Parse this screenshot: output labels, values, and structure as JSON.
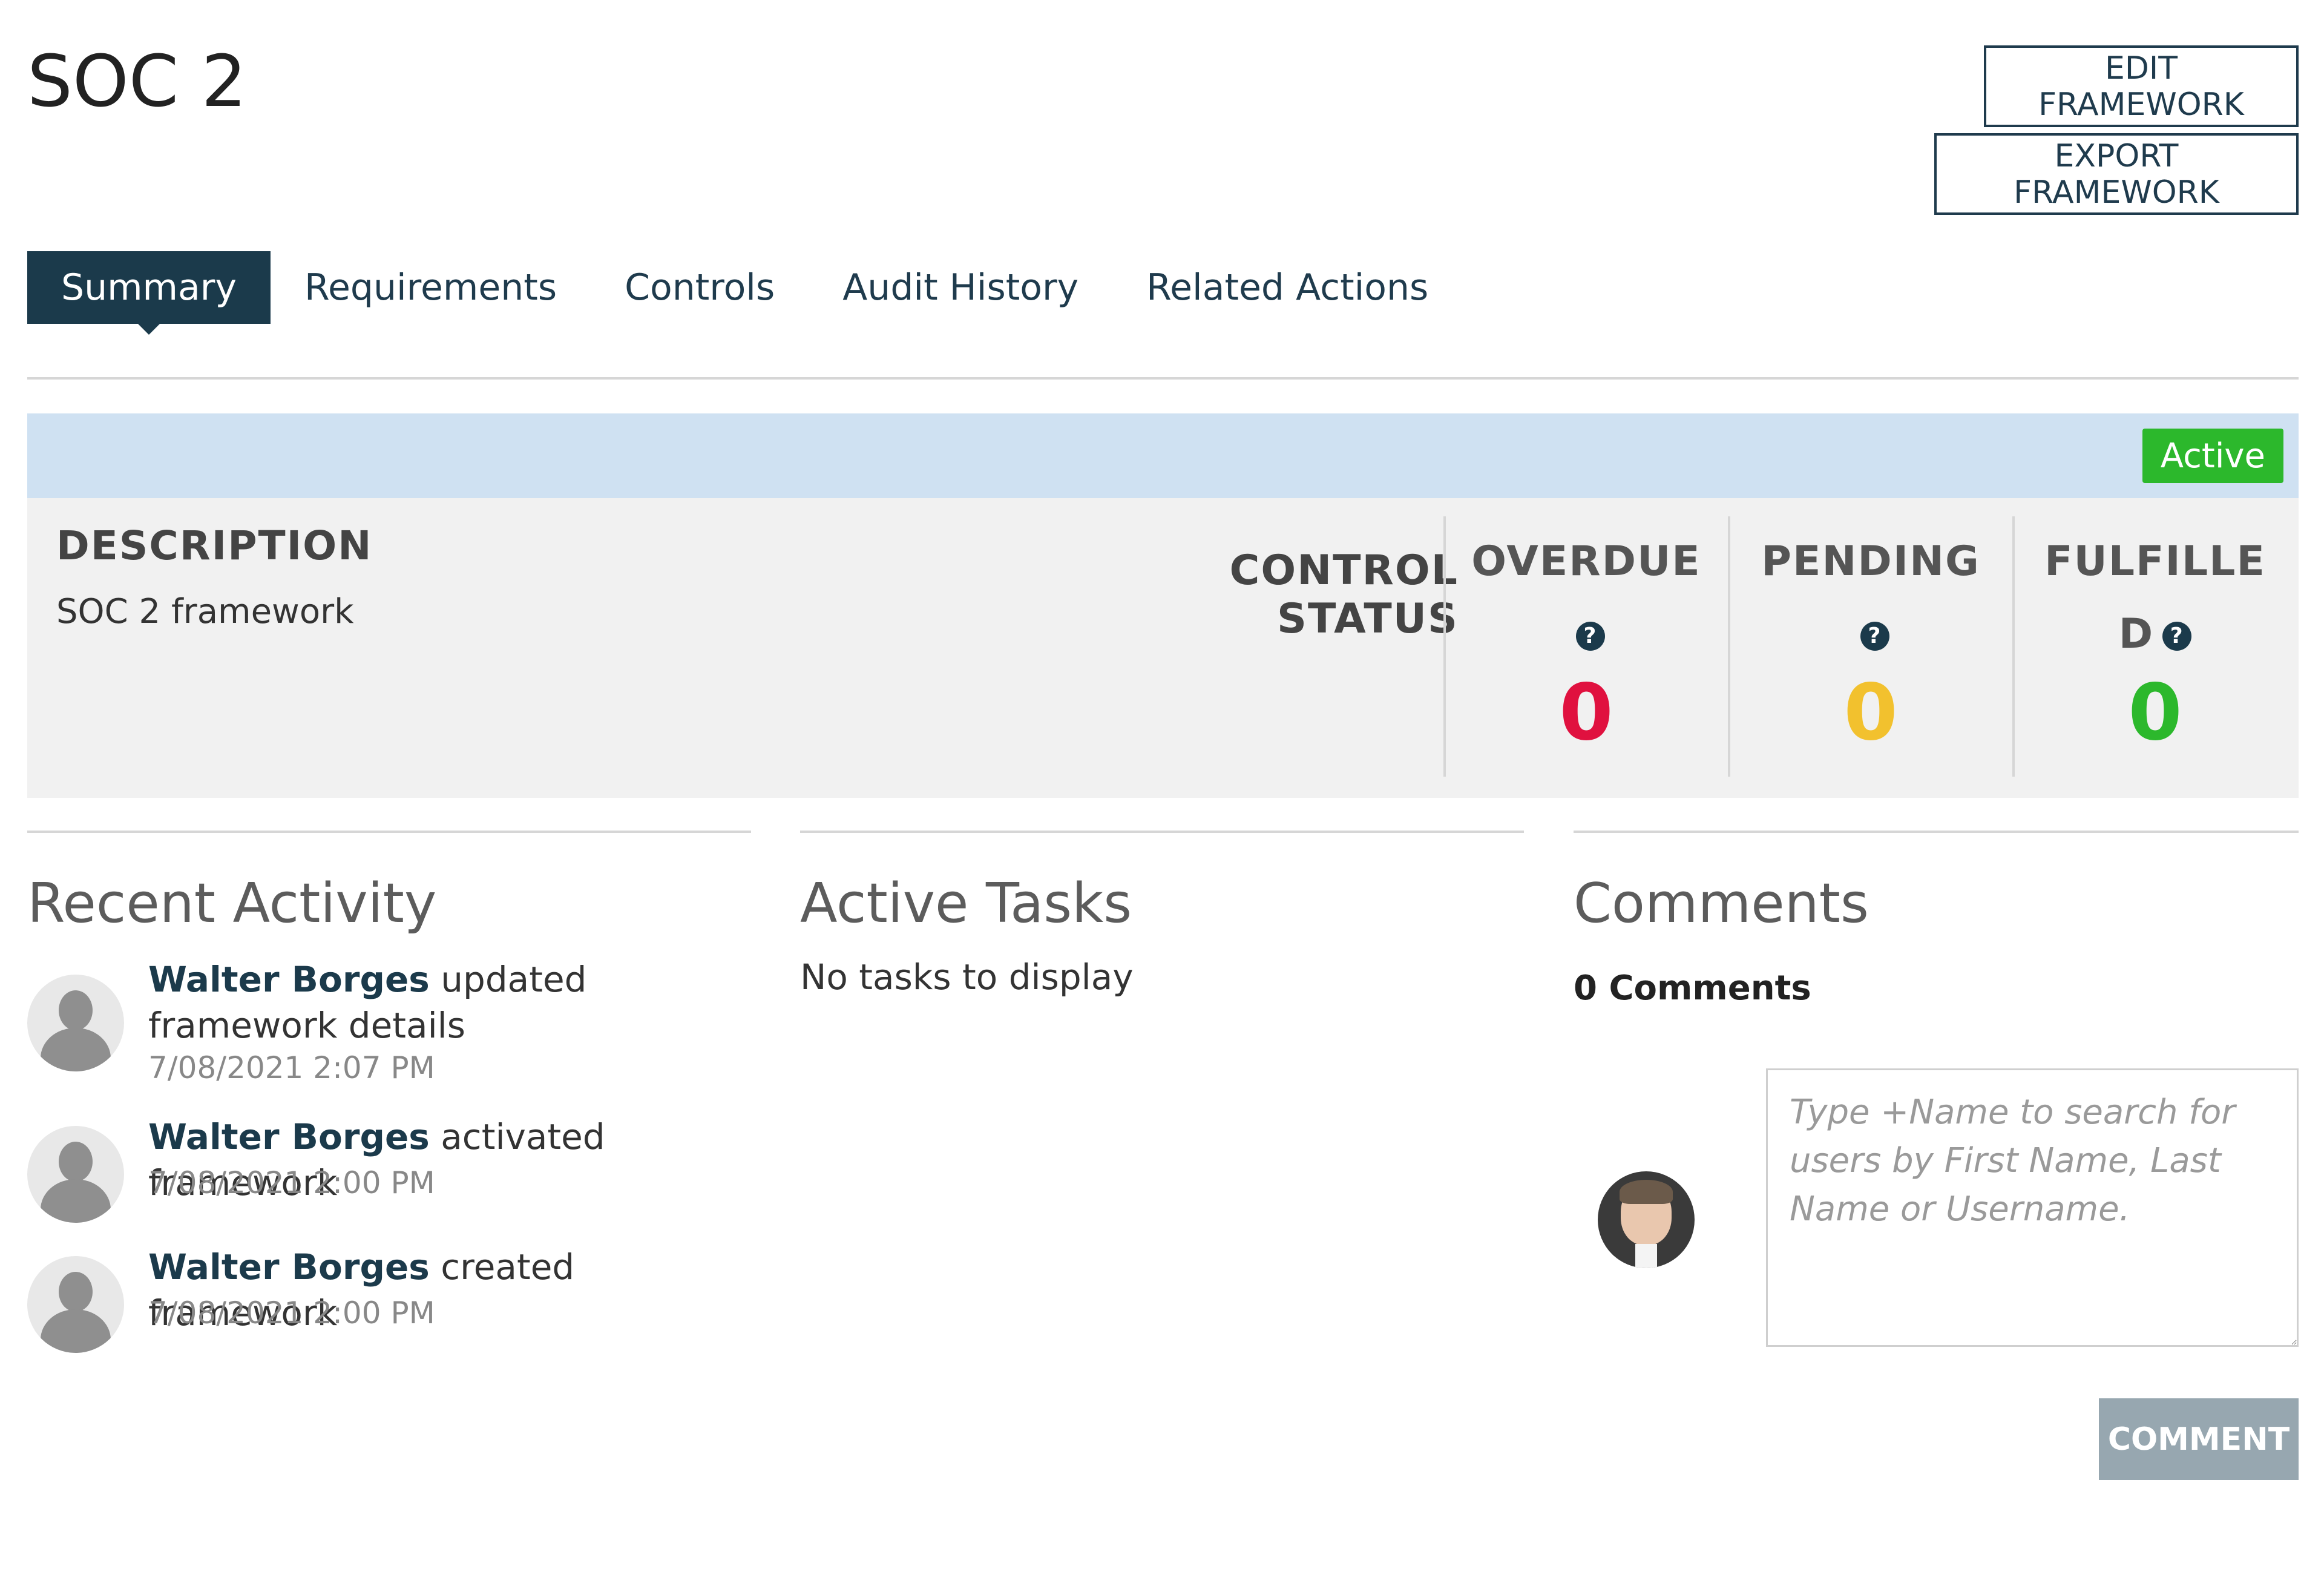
{
  "header": {
    "title": "SOC 2",
    "edit_label": "EDIT FRAMEWORK",
    "export_label": "EXPORT FRAMEWORK"
  },
  "tabs": [
    {
      "label": "Summary",
      "active": true
    },
    {
      "label": "Requirements",
      "active": false
    },
    {
      "label": "Controls",
      "active": false
    },
    {
      "label": "Audit History",
      "active": false
    },
    {
      "label": "Related Actions",
      "active": false
    }
  ],
  "status": {
    "badge": "Active",
    "badge_color": "#2cb82c"
  },
  "summary": {
    "description_heading": "DESCRIPTION",
    "description_text": "SOC 2 framework",
    "control_status_label": "CONTROL STATUS",
    "stats": [
      {
        "label": "OVERDUE",
        "value": "0",
        "color": "#e0113f"
      },
      {
        "label": "PENDING",
        "value": "0",
        "color": "#f2c12e"
      },
      {
        "label": "FULFILLED",
        "value": "0",
        "color": "#2cb82c"
      }
    ]
  },
  "recent_activity": {
    "title": "Recent Activity",
    "items": [
      {
        "user": "Walter Borges",
        "action": "updated framework details",
        "time": "7/08/2021 2:07 PM"
      },
      {
        "user": "Walter Borges",
        "action": "activated framework",
        "time": "7/08/2021 2:00 PM"
      },
      {
        "user": "Walter Borges",
        "action": "created framework",
        "time": "7/08/2021 2:00 PM"
      }
    ]
  },
  "active_tasks": {
    "title": "Active Tasks",
    "empty_text": "No tasks to display"
  },
  "comments": {
    "title": "Comments",
    "count_text": "0 Comments",
    "placeholder": "Type +Name to search for users by First Name, Last Name or Username.",
    "button_label": "COMMENT"
  },
  "icons": {
    "help": "question-circle-icon",
    "avatar": "user-silhouette-icon"
  }
}
